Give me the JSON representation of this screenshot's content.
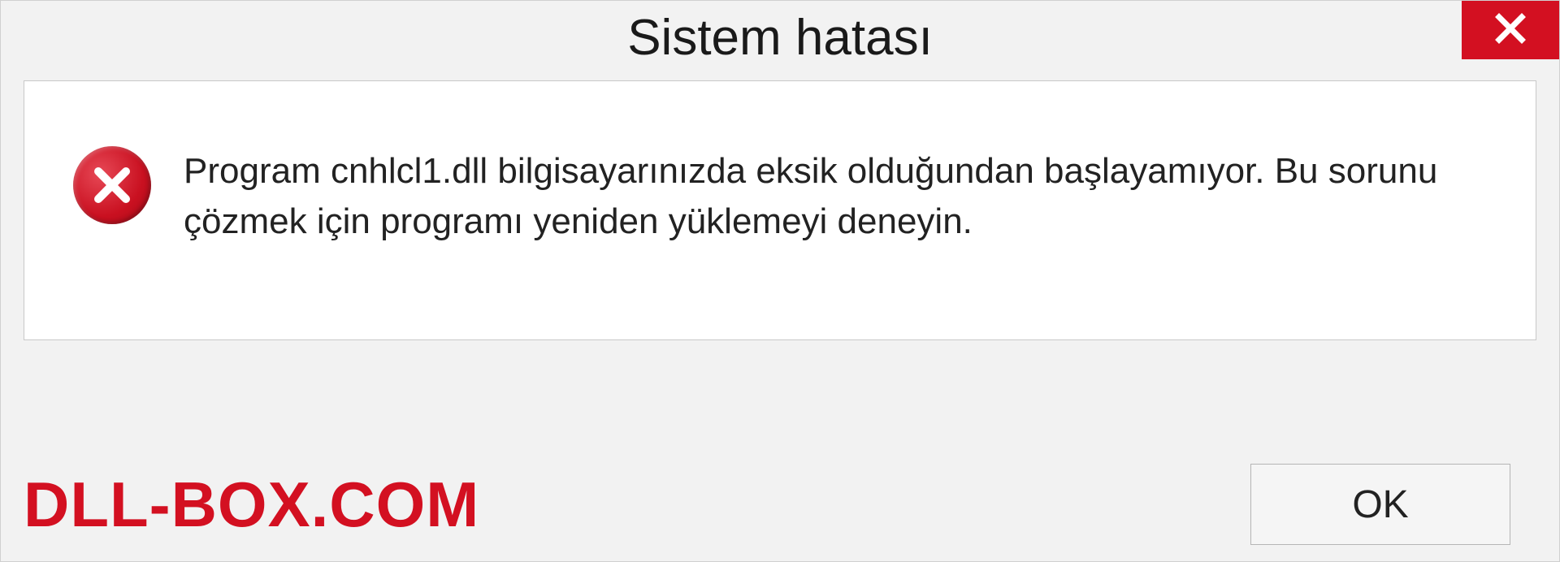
{
  "dialog": {
    "title": "Sistem hatası",
    "message": "Program cnhlcl1.dll bilgisayarınızda eksik olduğundan başlayamıyor. Bu sorunu çözmek için programı yeniden yüklemeyi deneyin.",
    "ok_label": "OK"
  },
  "watermark": {
    "text": "DLL-BOX.COM"
  },
  "colors": {
    "accent_red": "#d31021",
    "background": "#f2f2f2",
    "panel_white": "#ffffff"
  }
}
